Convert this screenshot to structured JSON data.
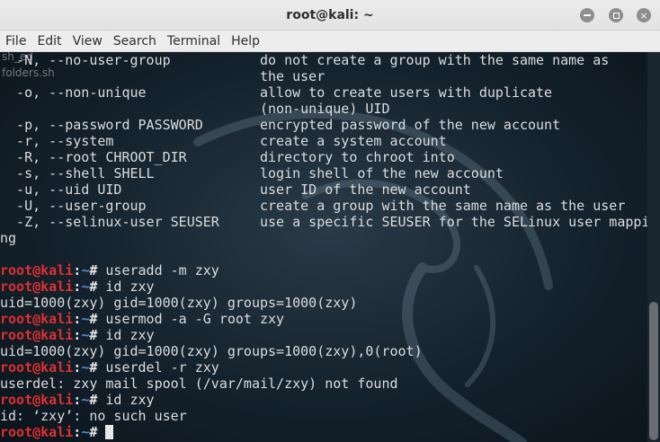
{
  "window": {
    "title": "root@kali: ~",
    "buttons": {
      "minimize": "minimize",
      "maximize": "maximize",
      "close": "×"
    }
  },
  "menu": [
    "File",
    "Edit",
    "View",
    "Search",
    "Terminal",
    "Help"
  ],
  "desktop_labels": [
    "sh_ed",
    "folders.sh"
  ],
  "prompt": {
    "user_host": "root@kali",
    "sep": ":",
    "path": "~",
    "symbol": "#"
  },
  "output_lines": [
    "  -N, --no-user-group           do not create a group with the same name as",
    "                                the user",
    "  -o, --non-unique              allow to create users with duplicate",
    "                                (non-unique) UID",
    "  -p, --password PASSWORD       encrypted password of the new account",
    "  -r, --system                  create a system account",
    "  -R, --root CHROOT_DIR         directory to chroot into",
    "  -s, --shell SHELL             login shell of the new account",
    "  -u, --uid UID                 user ID of the new account",
    "  -U, --user-group              create a group with the same name as the user",
    "  -Z, --selinux-user SEUSER     use a specific SEUSER for the SELinux user mappi",
    "ng",
    ""
  ],
  "session": [
    {
      "type": "cmd",
      "text": " useradd -m zxy"
    },
    {
      "type": "cmd",
      "text": " id zxy"
    },
    {
      "type": "out",
      "text": "uid=1000(zxy) gid=1000(zxy) groups=1000(zxy)"
    },
    {
      "type": "cmd",
      "text": " usermod -a -G root zxy"
    },
    {
      "type": "cmd",
      "text": " id zxy"
    },
    {
      "type": "out",
      "text": "uid=1000(zxy) gid=1000(zxy) groups=1000(zxy),0(root)"
    },
    {
      "type": "cmd",
      "text": " userdel -r zxy"
    },
    {
      "type": "out",
      "text": "userdel: zxy mail spool (/var/mail/zxy) not found"
    },
    {
      "type": "cmd",
      "text": " id zxy"
    },
    {
      "type": "out",
      "text": "id: ‘zxy’: no such user"
    },
    {
      "type": "cmd",
      "text": " "
    }
  ]
}
